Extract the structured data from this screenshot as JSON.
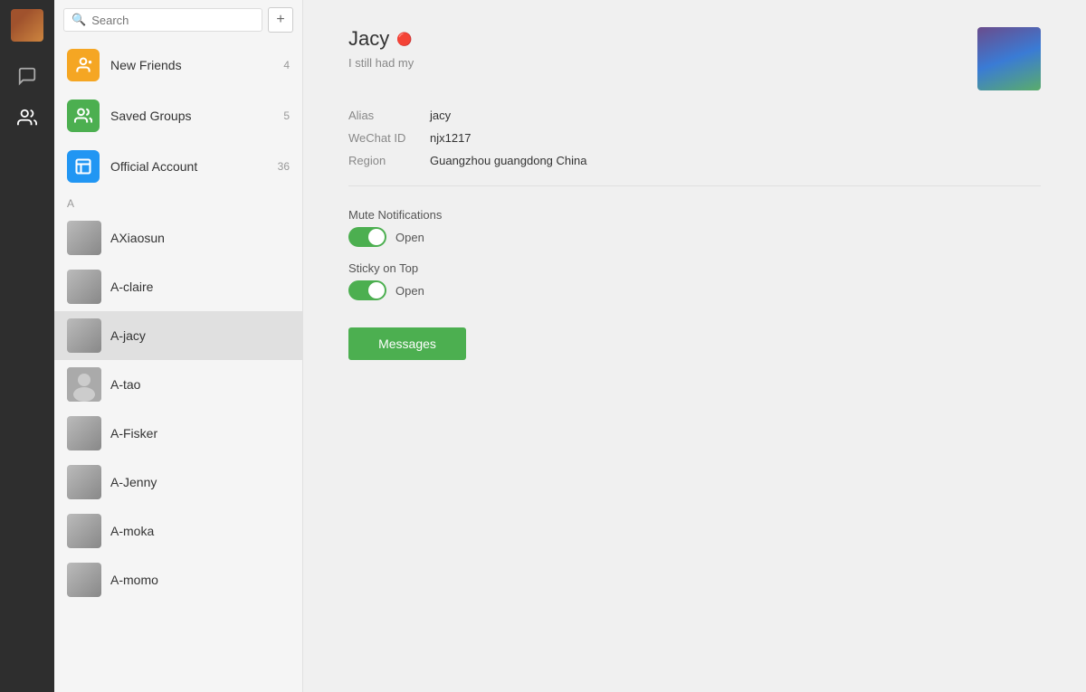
{
  "nav": {
    "icons": [
      {
        "name": "chat-icon",
        "glyph": "💬",
        "active": false
      },
      {
        "name": "contacts-icon",
        "glyph": "👤",
        "active": true
      }
    ]
  },
  "search": {
    "placeholder": "Search",
    "add_label": "+"
  },
  "special_items": [
    {
      "id": "new-friends",
      "label": "New Friends",
      "badge": "4",
      "icon_class": "icon-orange",
      "glyph": "👤"
    },
    {
      "id": "saved-groups",
      "label": "Saved Groups",
      "badge": "5",
      "icon_class": "icon-green",
      "glyph": "👥"
    },
    {
      "id": "official-account",
      "label": "Official Account",
      "badge": "36",
      "icon_class": "icon-blue",
      "glyph": "📋"
    }
  ],
  "group_header": "A",
  "contacts": [
    {
      "id": "axiaosun",
      "name": "AXiaosun",
      "av_class": "av-axiaosun",
      "active": false
    },
    {
      "id": "aclaire",
      "name": "A-claire",
      "av_class": "av-aclaire",
      "active": false
    },
    {
      "id": "ajacy",
      "name": "A-jacy",
      "av_class": "av-ajacy",
      "active": true
    },
    {
      "id": "atau",
      "name": "A-tao",
      "av_class": "av-atao",
      "active": false
    },
    {
      "id": "afisker",
      "name": "A-Fisker",
      "av_class": "av-afisker",
      "active": false
    },
    {
      "id": "ajenny",
      "name": "A-Jenny",
      "av_class": "av-ajenny",
      "active": false
    },
    {
      "id": "amoka",
      "name": "A-moka",
      "av_class": "av-amoka",
      "active": false
    },
    {
      "id": "amomo",
      "name": "A-momo",
      "av_class": "av-amomo",
      "active": false
    }
  ],
  "detail": {
    "name": "Jacy",
    "status": "I still had my",
    "alias_label": "Alias",
    "alias_value": "jacy",
    "wechat_label": "WeChat ID",
    "wechat_value": "njx1217",
    "region_label": "Region",
    "region_value": "Guangzhou guangdong China",
    "mute_title": "Mute Notifications",
    "mute_status": "Open",
    "sticky_title": "Sticky on Top",
    "sticky_status": "Open",
    "messages_btn": "Messages"
  }
}
